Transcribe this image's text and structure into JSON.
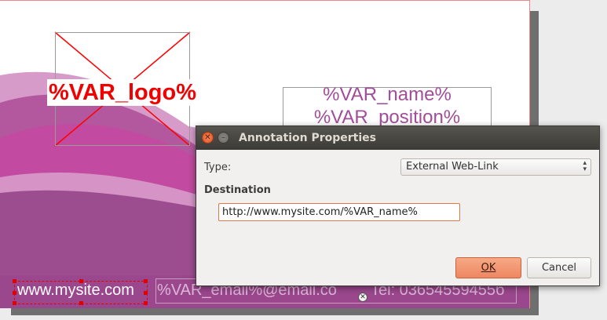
{
  "document": {
    "logo_placeholder": "%VAR_logo%",
    "name_placeholder": "%VAR_name%",
    "position_placeholder": "%VAR_position%",
    "website_text": "www.mysite.com",
    "email_text": "%VAR_email%@email.co",
    "phone_text": "Tel: 03654559455б"
  },
  "dialog": {
    "title": "Annotation Properties",
    "type_label": "Type:",
    "type_value": "External Web-Link",
    "destination_label": "Destination",
    "url_value": "http://www.mysite.com/%VAR_name%",
    "ok_label": "OK",
    "cancel_label": "Cancel"
  },
  "colors": {
    "accent": "#e8814f",
    "purple": "#a24d9a",
    "logo_red": "#f00000"
  }
}
